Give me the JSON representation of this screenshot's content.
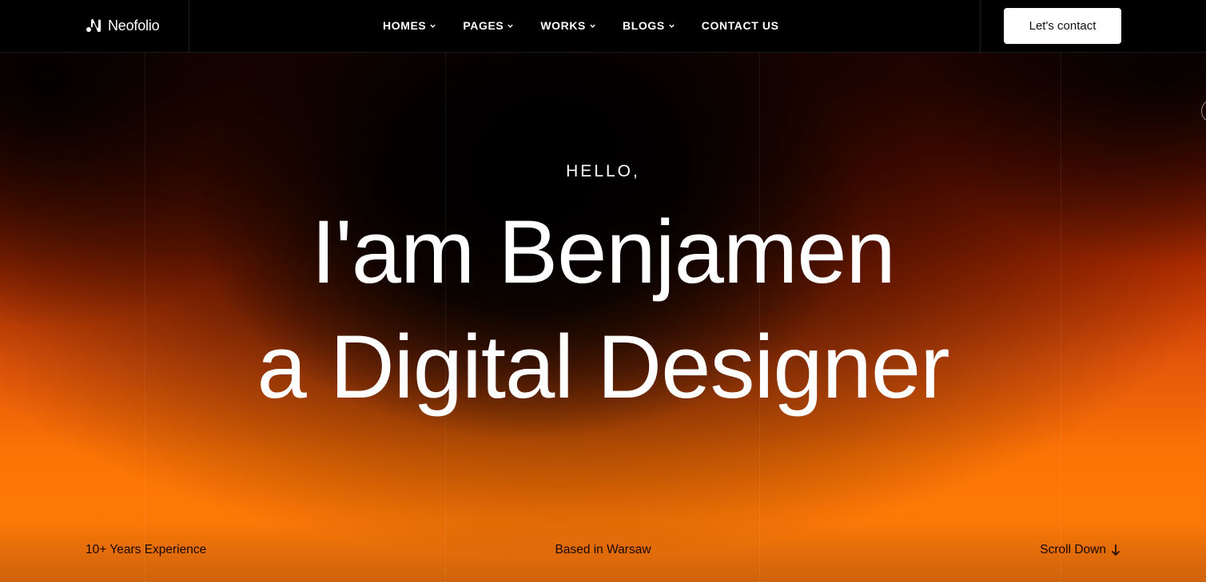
{
  "header": {
    "logo_text": "Neofolio",
    "nav": [
      {
        "label": "HOMES",
        "has_dropdown": true
      },
      {
        "label": "PAGES",
        "has_dropdown": true
      },
      {
        "label": "WORKS",
        "has_dropdown": true
      },
      {
        "label": "BLOGS",
        "has_dropdown": true
      },
      {
        "label": "CONTACT US",
        "has_dropdown": false
      }
    ],
    "cta_label": "Let's contact"
  },
  "hero": {
    "greeting": "HELLO,",
    "line1": "I'am Benjamen",
    "line2": "a Digital Designer"
  },
  "footer": {
    "experience": "10+ Years Experience",
    "location": "Based in Warsaw",
    "scroll": "Scroll Down"
  },
  "colors": {
    "header_bg": "#000000",
    "accent_orange": "#ff7a06",
    "deep_red": "#b93000",
    "button_bg": "#ffffff"
  }
}
